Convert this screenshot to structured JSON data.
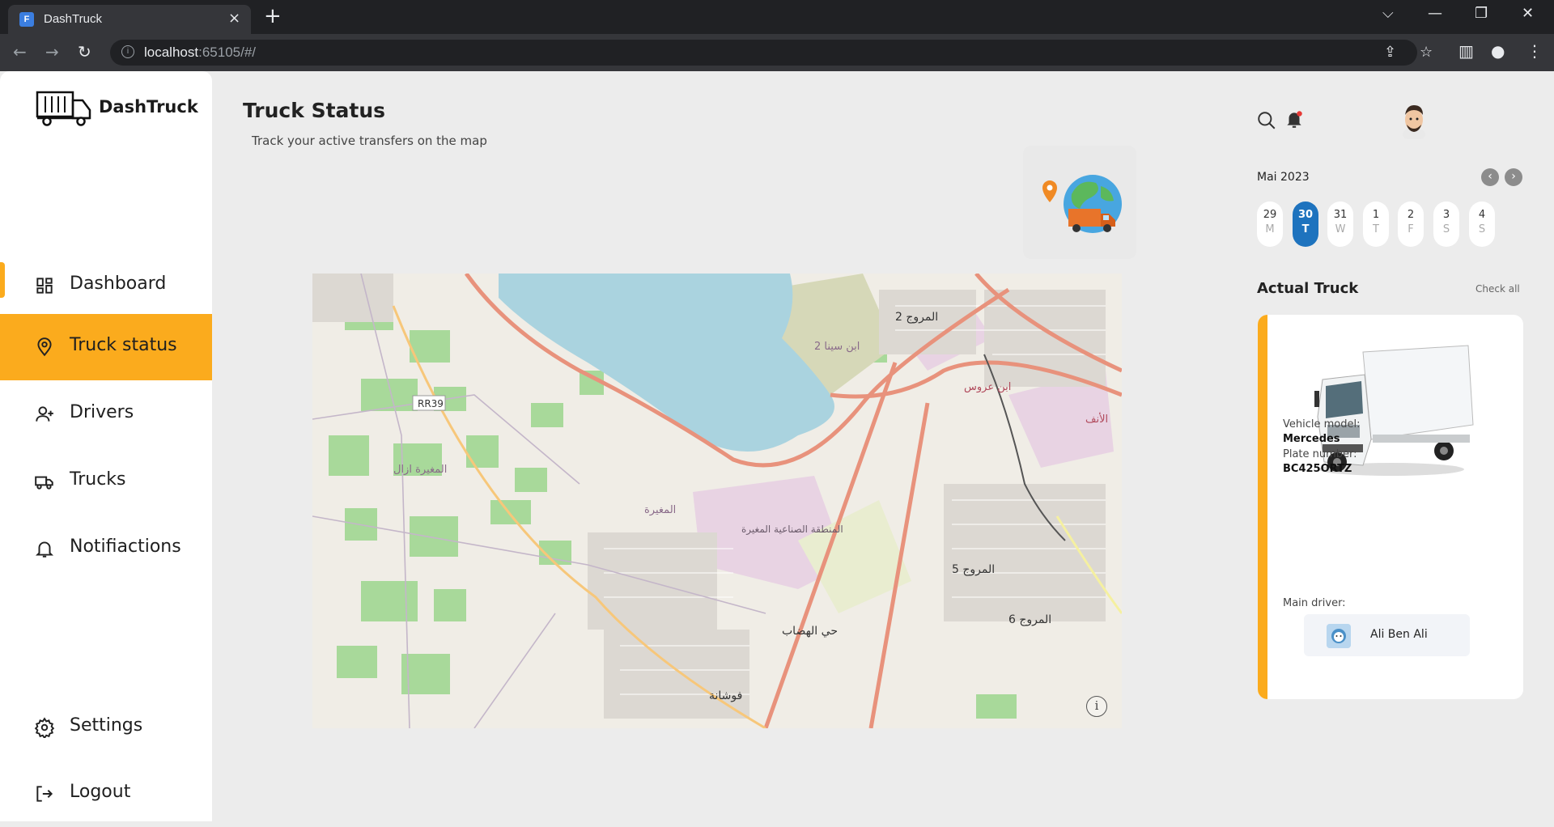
{
  "browser": {
    "tab_title": "DashTruck",
    "tab_close": "×",
    "new_tab": "+",
    "url_host": "localhost",
    "url_rest": ":65105/#/",
    "window_controls": [
      "⌵",
      "—",
      "❐",
      "✕"
    ]
  },
  "sidebar": {
    "brand": "DashTruck",
    "items": [
      {
        "label": "Dashboard",
        "icon": "dashboard-icon"
      },
      {
        "label": "Truck status",
        "icon": "location-pin-icon",
        "active": true
      },
      {
        "label": "Drivers",
        "icon": "add-person-icon"
      },
      {
        "label": "Trucks",
        "icon": "truck-icon"
      },
      {
        "label": "Notifiactions",
        "icon": "bell-icon"
      }
    ],
    "bottom_items": [
      {
        "label": "Settings",
        "icon": "gear-icon"
      },
      {
        "label": "Logout",
        "icon": "logout-icon"
      }
    ],
    "active_color": "#fbab1d"
  },
  "main": {
    "title": "Truck Status",
    "subtitle": "Track your active transfers on the map",
    "map": {
      "labels": [
        "RR39",
        "المروج 2",
        "ابن سينا 2",
        "المغيرة",
        "المنطقة الصناعية المغيرة",
        "المروج 5",
        "المروج 6",
        "حي الهضاب",
        "فوشانة",
        "ابن عروس",
        "الأنف",
        "المغيرة ازال"
      ]
    }
  },
  "right_panel": {
    "calendar": {
      "month": "Mai 2023",
      "prev": "‹",
      "next": "›",
      "days": [
        {
          "num": "29",
          "name": "M"
        },
        {
          "num": "30",
          "name": "T",
          "selected": true
        },
        {
          "num": "31",
          "name": "W"
        },
        {
          "num": "1",
          "name": "T"
        },
        {
          "num": "2",
          "name": "F"
        },
        {
          "num": "3",
          "name": "S"
        },
        {
          "num": "4",
          "name": "S"
        }
      ],
      "selected_color": "#1e73be"
    },
    "actual_truck": {
      "title": "Actual Truck",
      "check_all": "Check all",
      "vehicle_model_label": "Vehicle model:",
      "vehicle_model": "Mercedes",
      "plate_label": "Plate number:",
      "plate": "BC425ORTZ",
      "driver_label": "Main driver:",
      "driver_name": "Ali Ben Ali"
    }
  }
}
